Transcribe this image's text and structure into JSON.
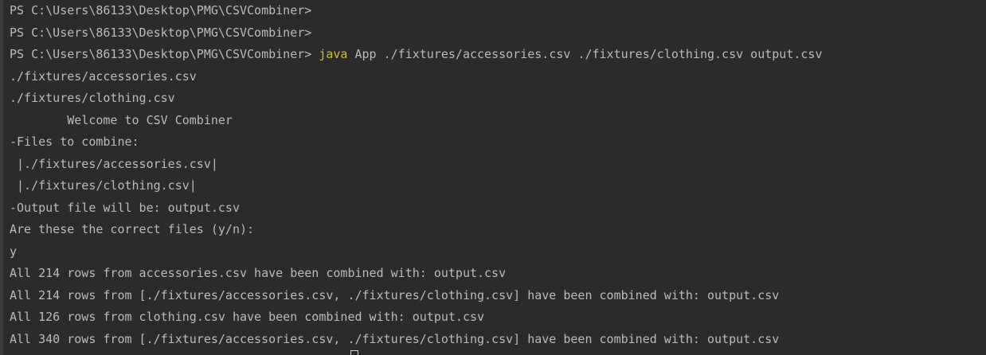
{
  "terminal": {
    "prompt": "PS C:\\Users\\86133\\Desktop\\PMG\\CSVCombiner> ",
    "command_keyword": "java",
    "command_rest": " App ./fixtures/accessories.csv ./fixtures/clothing.csv output.csv",
    "lines": [
      "PS C:\\Users\\86133\\Desktop\\PMG\\CSVCombiner>",
      "PS C:\\Users\\86133\\Desktop\\PMG\\CSVCombiner>",
      "./fixtures/accessories.csv",
      "./fixtures/clothing.csv",
      "        Welcome to CSV Combiner",
      "-Files to combine:",
      " |./fixtures/accessories.csv|",
      " |./fixtures/clothing.csv|",
      "-Output file will be: output.csv",
      "Are these the correct files (y/n):",
      "y",
      "All 214 rows from accessories.csv have been combined with: output.csv",
      "All 214 rows from [./fixtures/accessories.csv, ./fixtures/clothing.csv] have been combined with: output.csv",
      "All 126 rows from clothing.csv have been combined with: output.csv",
      "All 340 rows from [./fixtures/accessories.csv, ./fixtures/clothing.csv] have been combined with: output.csv"
    ]
  },
  "colors": {
    "background": "#2b2b2b",
    "text": "#bbbbbb",
    "keyword": "#d7ba3d"
  }
}
